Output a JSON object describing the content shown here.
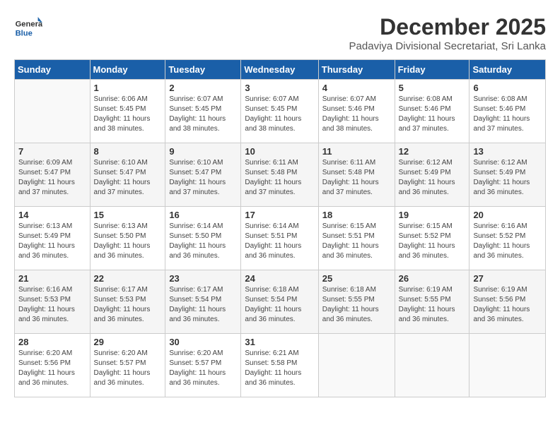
{
  "logo": {
    "general": "General",
    "blue": "Blue"
  },
  "title": {
    "month": "December 2025",
    "subtitle": "Padaviya Divisional Secretariat, Sri Lanka"
  },
  "weekdays": [
    "Sunday",
    "Monday",
    "Tuesday",
    "Wednesday",
    "Thursday",
    "Friday",
    "Saturday"
  ],
  "weeks": [
    [
      {
        "day": "",
        "sunrise": "",
        "sunset": "",
        "daylight": ""
      },
      {
        "day": "1",
        "sunrise": "Sunrise: 6:06 AM",
        "sunset": "Sunset: 5:45 PM",
        "daylight": "Daylight: 11 hours and 38 minutes."
      },
      {
        "day": "2",
        "sunrise": "Sunrise: 6:07 AM",
        "sunset": "Sunset: 5:45 PM",
        "daylight": "Daylight: 11 hours and 38 minutes."
      },
      {
        "day": "3",
        "sunrise": "Sunrise: 6:07 AM",
        "sunset": "Sunset: 5:45 PM",
        "daylight": "Daylight: 11 hours and 38 minutes."
      },
      {
        "day": "4",
        "sunrise": "Sunrise: 6:07 AM",
        "sunset": "Sunset: 5:46 PM",
        "daylight": "Daylight: 11 hours and 38 minutes."
      },
      {
        "day": "5",
        "sunrise": "Sunrise: 6:08 AM",
        "sunset": "Sunset: 5:46 PM",
        "daylight": "Daylight: 11 hours and 37 minutes."
      },
      {
        "day": "6",
        "sunrise": "Sunrise: 6:08 AM",
        "sunset": "Sunset: 5:46 PM",
        "daylight": "Daylight: 11 hours and 37 minutes."
      }
    ],
    [
      {
        "day": "7",
        "sunrise": "Sunrise: 6:09 AM",
        "sunset": "Sunset: 5:47 PM",
        "daylight": "Daylight: 11 hours and 37 minutes."
      },
      {
        "day": "8",
        "sunrise": "Sunrise: 6:10 AM",
        "sunset": "Sunset: 5:47 PM",
        "daylight": "Daylight: 11 hours and 37 minutes."
      },
      {
        "day": "9",
        "sunrise": "Sunrise: 6:10 AM",
        "sunset": "Sunset: 5:47 PM",
        "daylight": "Daylight: 11 hours and 37 minutes."
      },
      {
        "day": "10",
        "sunrise": "Sunrise: 6:11 AM",
        "sunset": "Sunset: 5:48 PM",
        "daylight": "Daylight: 11 hours and 37 minutes."
      },
      {
        "day": "11",
        "sunrise": "Sunrise: 6:11 AM",
        "sunset": "Sunset: 5:48 PM",
        "daylight": "Daylight: 11 hours and 37 minutes."
      },
      {
        "day": "12",
        "sunrise": "Sunrise: 6:12 AM",
        "sunset": "Sunset: 5:49 PM",
        "daylight": "Daylight: 11 hours and 36 minutes."
      },
      {
        "day": "13",
        "sunrise": "Sunrise: 6:12 AM",
        "sunset": "Sunset: 5:49 PM",
        "daylight": "Daylight: 11 hours and 36 minutes."
      }
    ],
    [
      {
        "day": "14",
        "sunrise": "Sunrise: 6:13 AM",
        "sunset": "Sunset: 5:49 PM",
        "daylight": "Daylight: 11 hours and 36 minutes."
      },
      {
        "day": "15",
        "sunrise": "Sunrise: 6:13 AM",
        "sunset": "Sunset: 5:50 PM",
        "daylight": "Daylight: 11 hours and 36 minutes."
      },
      {
        "day": "16",
        "sunrise": "Sunrise: 6:14 AM",
        "sunset": "Sunset: 5:50 PM",
        "daylight": "Daylight: 11 hours and 36 minutes."
      },
      {
        "day": "17",
        "sunrise": "Sunrise: 6:14 AM",
        "sunset": "Sunset: 5:51 PM",
        "daylight": "Daylight: 11 hours and 36 minutes."
      },
      {
        "day": "18",
        "sunrise": "Sunrise: 6:15 AM",
        "sunset": "Sunset: 5:51 PM",
        "daylight": "Daylight: 11 hours and 36 minutes."
      },
      {
        "day": "19",
        "sunrise": "Sunrise: 6:15 AM",
        "sunset": "Sunset: 5:52 PM",
        "daylight": "Daylight: 11 hours and 36 minutes."
      },
      {
        "day": "20",
        "sunrise": "Sunrise: 6:16 AM",
        "sunset": "Sunset: 5:52 PM",
        "daylight": "Daylight: 11 hours and 36 minutes."
      }
    ],
    [
      {
        "day": "21",
        "sunrise": "Sunrise: 6:16 AM",
        "sunset": "Sunset: 5:53 PM",
        "daylight": "Daylight: 11 hours and 36 minutes."
      },
      {
        "day": "22",
        "sunrise": "Sunrise: 6:17 AM",
        "sunset": "Sunset: 5:53 PM",
        "daylight": "Daylight: 11 hours and 36 minutes."
      },
      {
        "day": "23",
        "sunrise": "Sunrise: 6:17 AM",
        "sunset": "Sunset: 5:54 PM",
        "daylight": "Daylight: 11 hours and 36 minutes."
      },
      {
        "day": "24",
        "sunrise": "Sunrise: 6:18 AM",
        "sunset": "Sunset: 5:54 PM",
        "daylight": "Daylight: 11 hours and 36 minutes."
      },
      {
        "day": "25",
        "sunrise": "Sunrise: 6:18 AM",
        "sunset": "Sunset: 5:55 PM",
        "daylight": "Daylight: 11 hours and 36 minutes."
      },
      {
        "day": "26",
        "sunrise": "Sunrise: 6:19 AM",
        "sunset": "Sunset: 5:55 PM",
        "daylight": "Daylight: 11 hours and 36 minutes."
      },
      {
        "day": "27",
        "sunrise": "Sunrise: 6:19 AM",
        "sunset": "Sunset: 5:56 PM",
        "daylight": "Daylight: 11 hours and 36 minutes."
      }
    ],
    [
      {
        "day": "28",
        "sunrise": "Sunrise: 6:20 AM",
        "sunset": "Sunset: 5:56 PM",
        "daylight": "Daylight: 11 hours and 36 minutes."
      },
      {
        "day": "29",
        "sunrise": "Sunrise: 6:20 AM",
        "sunset": "Sunset: 5:57 PM",
        "daylight": "Daylight: 11 hours and 36 minutes."
      },
      {
        "day": "30",
        "sunrise": "Sunrise: 6:20 AM",
        "sunset": "Sunset: 5:57 PM",
        "daylight": "Daylight: 11 hours and 36 minutes."
      },
      {
        "day": "31",
        "sunrise": "Sunrise: 6:21 AM",
        "sunset": "Sunset: 5:58 PM",
        "daylight": "Daylight: 11 hours and 36 minutes."
      },
      {
        "day": "",
        "sunrise": "",
        "sunset": "",
        "daylight": ""
      },
      {
        "day": "",
        "sunrise": "",
        "sunset": "",
        "daylight": ""
      },
      {
        "day": "",
        "sunrise": "",
        "sunset": "",
        "daylight": ""
      }
    ]
  ]
}
